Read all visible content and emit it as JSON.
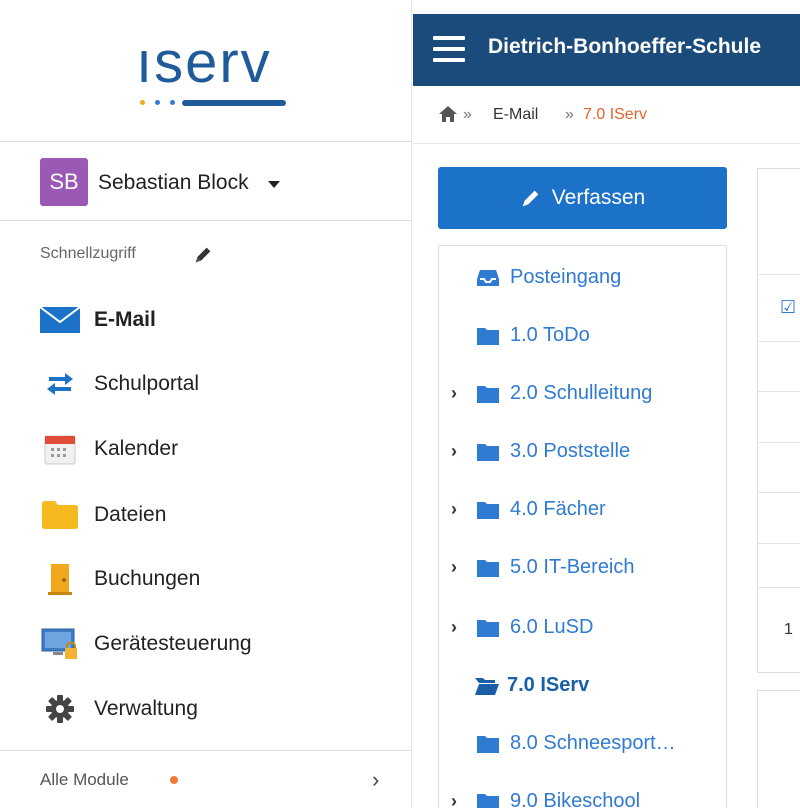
{
  "logo": {
    "text": "ıserv",
    "dot_colors": [
      "#f5a623",
      "#2f7bd3",
      "#2f7bd3"
    ],
    "brand_color": "#1f5b9a"
  },
  "user": {
    "initials": "SB",
    "name": "Sebastian Block",
    "avatar_color": "#9b59b6"
  },
  "sidebar": {
    "quick_access_label": "Schnellzugriff",
    "items": [
      {
        "label": "E-Mail",
        "icon": "mail-icon",
        "active": true
      },
      {
        "label": "Schulportal",
        "icon": "exchange-arrows-icon"
      },
      {
        "label": "Kalender",
        "icon": "calendar-icon"
      },
      {
        "label": "Dateien",
        "icon": "folder-icon"
      },
      {
        "label": "Buchungen",
        "icon": "door-icon"
      },
      {
        "label": "Gerätesteuerung",
        "icon": "monitor-lock-icon"
      },
      {
        "label": "Verwaltung",
        "icon": "gear-icon"
      }
    ],
    "all_modules_label": "Alle Module"
  },
  "topbar": {
    "school_name": "Dietrich-Bonhoeffer-Schule",
    "color": "#1a4b7a"
  },
  "breadcrumb": {
    "sep": "»",
    "email": "E-Mail",
    "current": "7.0 IServ"
  },
  "compose": {
    "label": "Verfassen"
  },
  "folders": [
    {
      "label": "Posteingang",
      "icon": "inbox-icon",
      "expandable": false
    },
    {
      "label": "1.0 ToDo",
      "icon": "folder-icon",
      "expandable": false
    },
    {
      "label": "2.0 Schulleitung",
      "icon": "folder-icon",
      "expandable": true
    },
    {
      "label": "3.0 Poststelle",
      "icon": "folder-icon",
      "expandable": true
    },
    {
      "label": "4.0 Fächer",
      "icon": "folder-icon",
      "expandable": true
    },
    {
      "label": "5.0 IT-Bereich",
      "icon": "folder-icon",
      "expandable": true
    },
    {
      "label": "6.0 LuSD",
      "icon": "folder-icon",
      "expandable": true
    },
    {
      "label": "7.0 IServ",
      "icon": "folder-open-icon",
      "expandable": false,
      "active": true
    },
    {
      "label": "8.0 Schneesport…",
      "icon": "folder-icon",
      "expandable": false
    },
    {
      "label": "9.0 Bikeschool",
      "icon": "folder-icon",
      "expandable": true
    }
  ],
  "right": {
    "row_number": "1"
  }
}
